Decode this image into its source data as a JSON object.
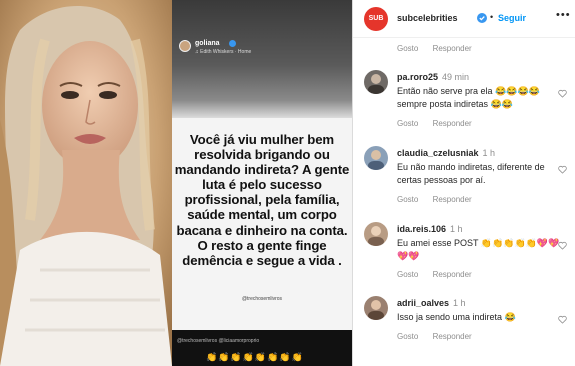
{
  "post": {
    "username": "subcelebrities",
    "avatar_text": "SUB",
    "follow_label": "Seguir",
    "dot": "•",
    "more": "•••"
  },
  "story": {
    "username": "goliana",
    "music": "♫ Edith Whiskers · Home",
    "text": "Você já viu mulher bem resolvida brigando ou mandando indireta? A gente luta é pelo sucesso profissional, pela família, saúde mental, um corpo bacana e dinheiro na conta. O resto a gente finge demência e segue a vida .",
    "credit": "@trechosemlivros",
    "bottom_text": "@trechosemlivros  @liciaamorproprio",
    "emojis": "👏👏👏👏👏👏👏👏"
  },
  "caption_actions": {
    "like": "Gosto",
    "reply": "Responder"
  },
  "comments": [
    {
      "username": "pa.roro25",
      "time": "49 min",
      "text": "Então não serve pra ela 😂😂😂😂 sempre posta indiretas 😂😂",
      "like": "Gosto",
      "reply": "Responder",
      "avatar_color": "#6f6a66"
    },
    {
      "username": "claudia_czelusniak",
      "time": "1 h",
      "text": "Eu não mando indiretas, diferente de certas pessoas por aí.",
      "like": "Gosto",
      "reply": "Responder",
      "avatar_color": "#8aa0b8"
    },
    {
      "username": "ida.reis.106",
      "time": "1 h",
      "text": "Eu amei esse POST 👏👏👏👏👏💖💖💖💖",
      "like": "Gosto",
      "reply": "Responder",
      "avatar_color": "#b89c84"
    },
    {
      "username": "adrii_oalves",
      "time": "1 h",
      "text": "Isso ja sendo uma indireta 😂",
      "like": "Gosto",
      "reply": "Responder",
      "avatar_color": "#9a8070"
    }
  ],
  "colors": {
    "link_blue": "#0095f6",
    "verified_blue": "#3897f0",
    "brand_red": "#e5352b",
    "muted": "#8e8e8e"
  }
}
